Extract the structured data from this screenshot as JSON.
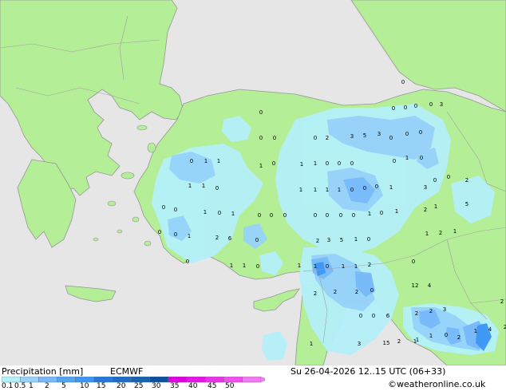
{
  "title": "Precipitation [mm]",
  "model": "ECMWF",
  "valid_time": "Su 26-04-2026 12..15 UTC (06+33)",
  "credit": "©weatheronline.co.uk",
  "legend": {
    "ticks": [
      "0.1",
      "0.5",
      "1",
      "2",
      "5",
      "10",
      "15",
      "20",
      "25",
      "30",
      "35",
      "40",
      "45",
      "50"
    ],
    "colors": [
      "#b4f0fa",
      "#96d2fa",
      "#78b9fa",
      "#50a5f5",
      "#3c96f5",
      "#2878dc",
      "#1e6ec8",
      "#1464b4",
      "#0a50a0",
      "#e100e1",
      "#e614e6",
      "#eb32eb",
      "#f050f0",
      "#f578f5"
    ]
  },
  "colors": {
    "land": "#b4ee96",
    "sea": "#e6e6e6",
    "coast": "#969696",
    "border": "#a0a0a0"
  },
  "station_values": [
    "0",
    "0",
    "0",
    "0",
    "0",
    "1",
    "0",
    "0",
    "0",
    "0",
    "0",
    "3",
    "0",
    "0",
    "0",
    "1",
    "1",
    "0",
    "0",
    "0",
    "2",
    "3",
    "5",
    "3",
    "0",
    "1",
    "0",
    "0",
    "0",
    "2",
    "0",
    "1",
    "1",
    "1",
    "1",
    "0",
    "1",
    "1",
    "1",
    "1",
    "0",
    "0",
    "0",
    "1",
    "3",
    "2",
    "5",
    "1",
    "0",
    "0",
    "1",
    "0",
    "1",
    "0",
    "0",
    "0",
    "0",
    "0",
    "0",
    "0",
    "1",
    "0",
    "1",
    "1",
    "2",
    "1",
    "0",
    "0",
    "1",
    "2",
    "6",
    "0",
    "2",
    "3",
    "5",
    "1",
    "0",
    "0",
    "1",
    "1",
    "0",
    "1",
    "1",
    "0",
    "1",
    "1",
    "2",
    "0",
    "12",
    "4",
    "2",
    "2",
    "2",
    "0",
    "0",
    "0",
    "2",
    "2",
    "3",
    "1",
    "1",
    "0",
    "2",
    "4",
    "2",
    "1",
    "2",
    "6",
    "3",
    "15",
    "2",
    "1",
    "1",
    "1",
    "10",
    "0",
    "0",
    "0",
    "0"
  ]
}
